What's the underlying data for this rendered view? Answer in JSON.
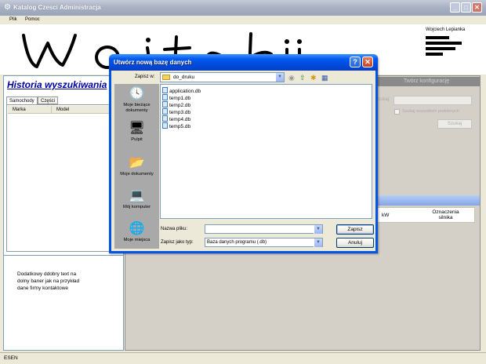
{
  "app": {
    "title": "Katalog Czesci Administracja",
    "controls": {
      "minimize": "_",
      "maximize": "□",
      "close": "✕"
    }
  },
  "menu": [
    "Plik",
    "Pomoc"
  ],
  "banner": {
    "signature": "Wojtek",
    "owner_name": "Wojciech Lepianka"
  },
  "left_panel": {
    "title": "Historia wyszukiwania",
    "tabs": [
      "Samochody",
      "Części"
    ],
    "columns": [
      "Marka",
      "Model"
    ],
    "info_text": "Dodatkowy ddobry text na\ndolny baner jak na przykład\ndane firmy kontaktowe"
  },
  "right_panel": {
    "config_button": "Twórz konfigurację",
    "search_label": "Szukaj:",
    "similar_checkbox": "Szukaj wszystkich podobnych",
    "search_button": "Szukaj",
    "columns": [
      "kW",
      "Oznaczenia silnika"
    ]
  },
  "status_bar": {
    "text": "ESEN"
  },
  "dialog": {
    "title": "Utwórz nową bazę danych",
    "help": "?",
    "close": "✕",
    "look_in_label": "Zapisz w:",
    "look_in_value": "do_druku",
    "places": [
      {
        "label": "Moje bieżące dokumenty",
        "icon": "recent-documents-icon",
        "glyph": "🕓"
      },
      {
        "label": "Pulpit",
        "icon": "desktop-icon",
        "glyph": "🖥"
      },
      {
        "label": "Moje dokumenty",
        "icon": "my-documents-icon",
        "glyph": "📂"
      },
      {
        "label": "Mój komputer",
        "icon": "my-computer-icon",
        "glyph": "💻"
      },
      {
        "label": "Moje miejsca",
        "icon": "network-places-icon",
        "glyph": "🌐"
      }
    ],
    "files": [
      "application.db",
      "temp1.db",
      "temp2.db",
      "temp3.db",
      "temp4.db",
      "temp5.db"
    ],
    "filename_label": "Nazwa pliku:",
    "filename_value": "",
    "filetype_label": "Zapisz jako typ:",
    "filetype_value": "Baza danych programu (.db)",
    "save_button": "Zapisz",
    "cancel_button": "Anuluj",
    "toolbar": [
      {
        "icon": "back-icon",
        "glyph": "◉"
      },
      {
        "icon": "up-folder-icon",
        "glyph": "⇧"
      },
      {
        "icon": "new-folder-icon",
        "glyph": "✱"
      },
      {
        "icon": "view-menu-icon",
        "glyph": "▦"
      }
    ]
  }
}
